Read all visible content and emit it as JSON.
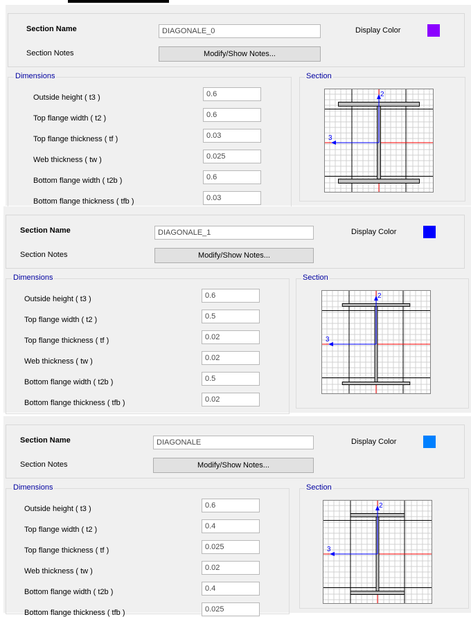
{
  "labels": {
    "section_name": "Section Name",
    "section_notes": "Section Notes",
    "display_color": "Display Color",
    "modify_notes": "Modify/Show Notes...",
    "dimensions": "Dimensions",
    "section": "Section",
    "axis_2": "2",
    "axis_3": "3"
  },
  "dimension_labels": [
    "Outside height  ( t3 )",
    "Top flange width  ( t2 )",
    "Top flange thickness  ( tf )",
    "Web thickness  ( tw )",
    "Bottom flange width  ( t2b )",
    "Bottom flange thickness  ( tfb )"
  ],
  "sections": [
    {
      "name": "DIAGONALE_0",
      "color": "#8B00FF",
      "values": [
        "0.6",
        "0.6",
        "0.03",
        "0.025",
        "0.6",
        "0.03"
      ]
    },
    {
      "name": "DIAGONALE_1",
      "color": "#0000FF",
      "values": [
        "0.6",
        "0.5",
        "0.02",
        "0.02",
        "0.5",
        "0.02"
      ]
    },
    {
      "name": "DIAGONALE",
      "color": "#0080FF",
      "values": [
        "0.6",
        "0.4",
        "0.025",
        "0.02",
        "0.4",
        "0.025"
      ]
    }
  ]
}
